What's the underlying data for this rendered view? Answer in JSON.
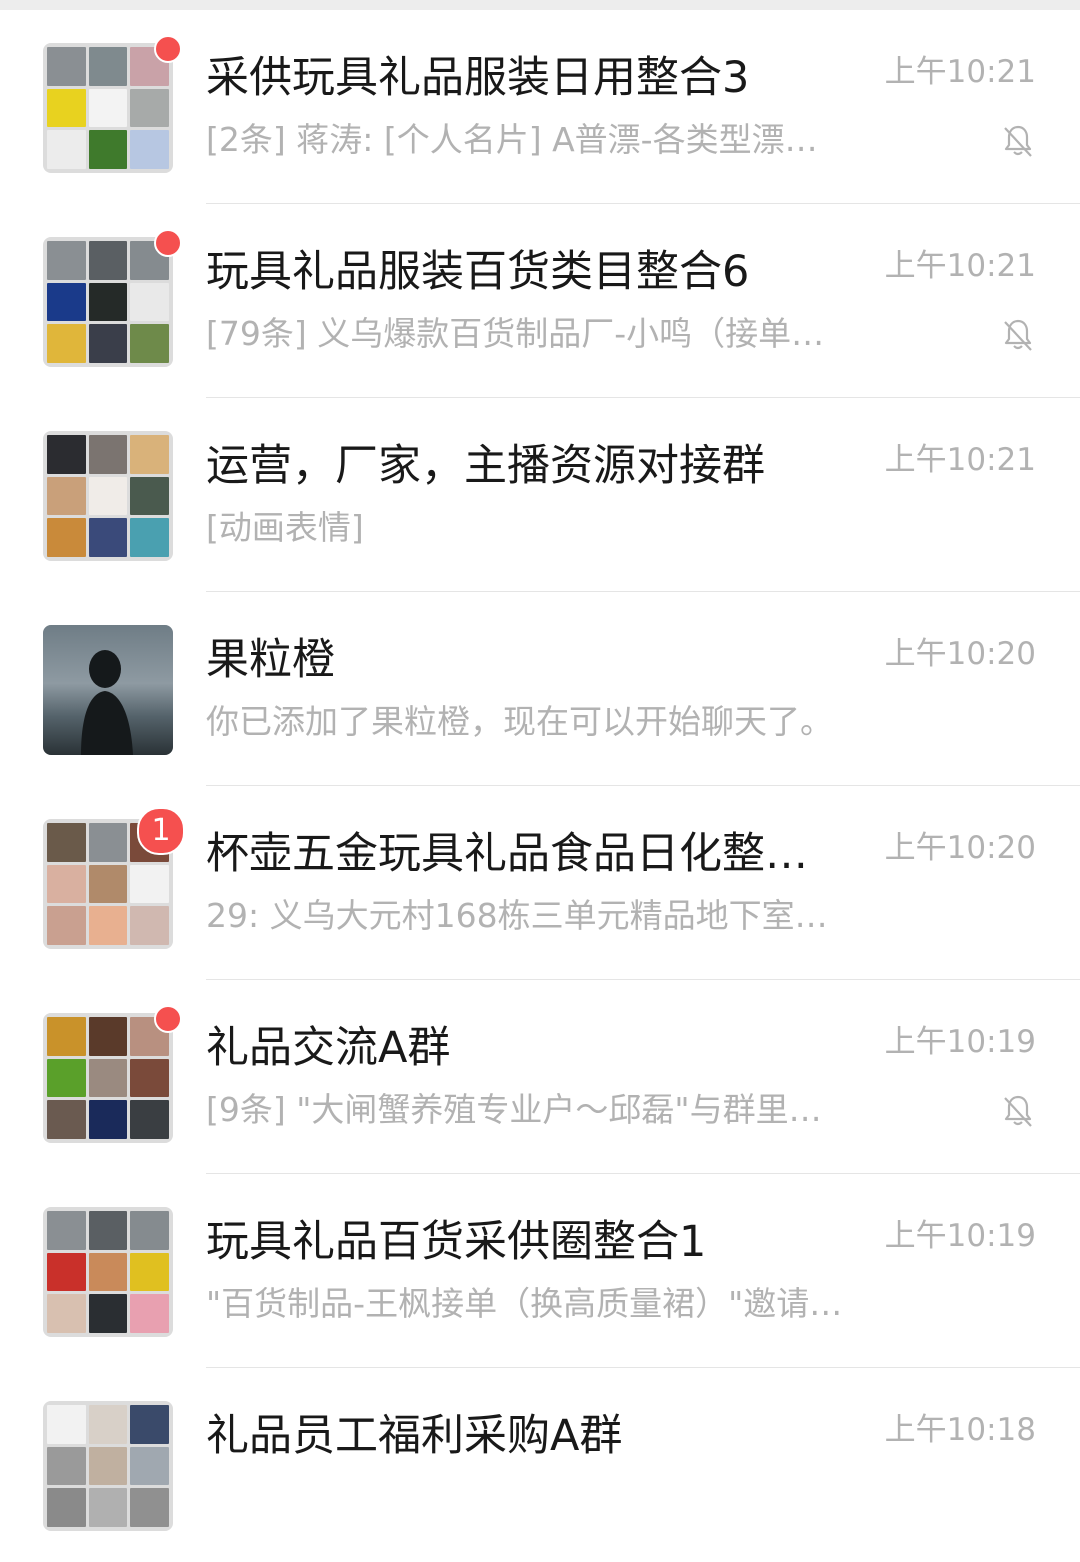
{
  "colors": {
    "background": "#ffffff",
    "title": "#191919",
    "subtext": "#b2b2b2",
    "badge": "#f5504f",
    "divider": "#e5e5e5"
  },
  "chats": [
    {
      "title": "采供玩具礼品服装日用整合3",
      "preview": "[2条] 蒋涛: [个人名片] A普漂-各类型漂…",
      "time": "上午10:21",
      "muted": true,
      "indicator": "dot"
    },
    {
      "title": "玩具礼品服装百货类目整合6",
      "preview": "[79条] 义乌爆款百货制品厂-小鸣（接单…",
      "time": "上午10:21",
      "muted": true,
      "indicator": "dot"
    },
    {
      "title": "运营，厂家，主播资源对接群",
      "preview": "[动画表情]",
      "time": "上午10:21",
      "muted": false,
      "indicator": "none"
    },
    {
      "title": "果粒橙",
      "preview": "你已添加了果粒橙，现在可以开始聊天了。",
      "time": "上午10:20",
      "muted": false,
      "indicator": "none"
    },
    {
      "title": "杯壶五金玩具礼品食品日化整…",
      "preview": "29: 义乌大元村168栋三单元精品地下室…",
      "time": "上午10:20",
      "muted": false,
      "indicator": "count",
      "unread": "1"
    },
    {
      "title": "礼品交流A群",
      "preview": "[9条] \"大闸蟹养殖专业户～邱磊\"与群里…",
      "time": "上午10:19",
      "muted": true,
      "indicator": "dot"
    },
    {
      "title": "玩具礼品百货采供圈整合1",
      "preview": "\"百货制品-王枫接单（换高质量裙）\"邀请…",
      "time": "上午10:19",
      "muted": false,
      "indicator": "none"
    },
    {
      "title": "礼品员工福利采购A群",
      "preview": "",
      "time": "上午10:18",
      "muted": false,
      "indicator": "none"
    }
  ]
}
